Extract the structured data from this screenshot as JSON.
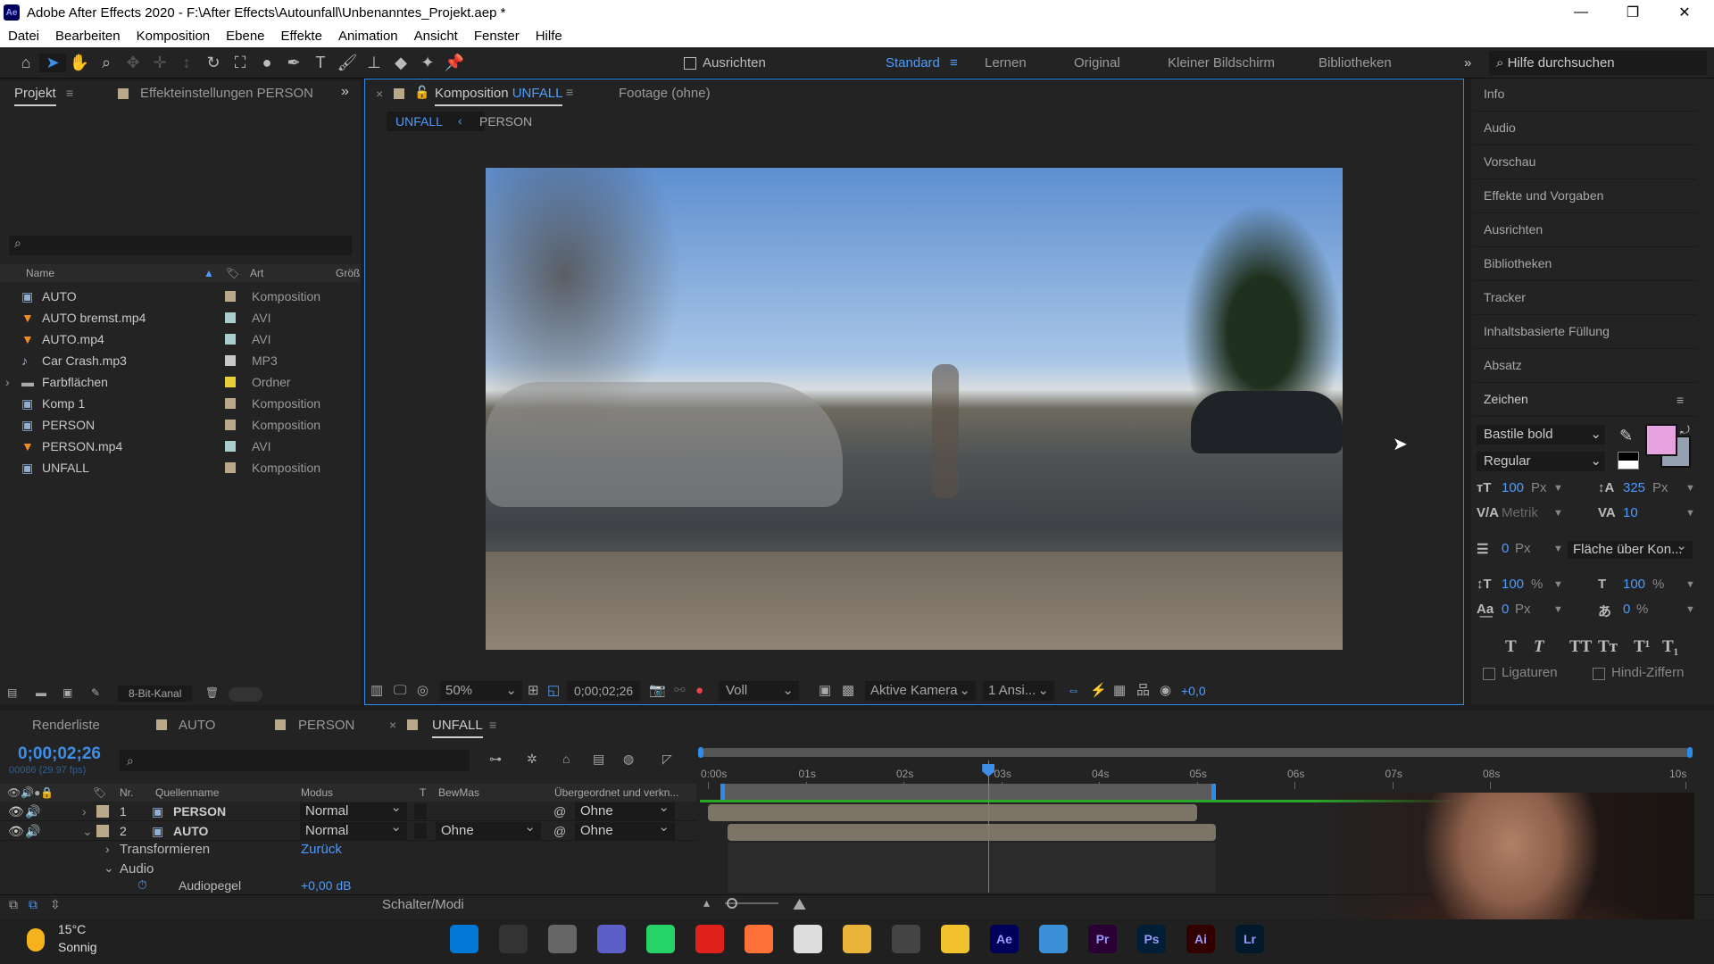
{
  "window": {
    "title": "Adobe After Effects 2020 - F:\\After Effects\\Autounfall\\Unbenanntes_Projekt.aep *",
    "logo": "Ae"
  },
  "menu": [
    "Datei",
    "Bearbeiten",
    "Komposition",
    "Ebene",
    "Effekte",
    "Animation",
    "Ansicht",
    "Fenster",
    "Hilfe"
  ],
  "toolbar": {
    "align_label": "Ausrichten",
    "workspaces": [
      "Standard",
      "Lernen",
      "Original",
      "Kleiner Bildschirm",
      "Bibliotheken"
    ],
    "active_workspace": "Standard",
    "help_placeholder": "Hilfe durchsuchen"
  },
  "project": {
    "tabs": [
      "Projekt",
      "Effekteinstellungen PERSON"
    ],
    "columns": [
      "Name",
      "Art",
      "Größ"
    ],
    "items": [
      {
        "name": "AUTO",
        "type": "Komposition",
        "icon": "composition-icon",
        "color": "#b9a98a"
      },
      {
        "name": "AUTO bremst.mp4",
        "type": "AVI",
        "icon": "video-file-icon",
        "color": "#a9cccc"
      },
      {
        "name": "AUTO.mp4",
        "type": "AVI",
        "icon": "video-file-icon",
        "color": "#a9cccc"
      },
      {
        "name": "Car Crash.mp3",
        "type": "MP3",
        "icon": "audio-file-icon",
        "color": "#c7c7c7"
      },
      {
        "name": "Farbflächen",
        "type": "Ordner",
        "icon": "folder-icon",
        "color": "#e6cf3c"
      },
      {
        "name": "Komp 1",
        "type": "Komposition",
        "icon": "composition-icon",
        "color": "#b9a98a"
      },
      {
        "name": "PERSON",
        "type": "Komposition",
        "icon": "composition-icon",
        "color": "#b9a98a"
      },
      {
        "name": "PERSON.mp4",
        "type": "AVI",
        "icon": "video-file-icon",
        "color": "#a9cccc"
      },
      {
        "name": "UNFALL",
        "type": "Komposition",
        "icon": "composition-icon",
        "color": "#b9a98a"
      }
    ],
    "bit_depth": "8-Bit-Kanal"
  },
  "composition": {
    "tab_prefix": "Komposition",
    "tab_name": "UNFALL",
    "footage_tab": "Footage (ohne)",
    "breadcrumbs": [
      "UNFALL",
      "PERSON"
    ],
    "zoom": "50%",
    "timecode": "0;00;02;26",
    "resolution": "Voll",
    "camera": "Aktive Kamera",
    "views": "1 Ansi...",
    "exposure": "+0,0"
  },
  "right_panel": {
    "sections": [
      "Info",
      "Audio",
      "Vorschau",
      "Effekte und Vorgaben",
      "Ausrichten",
      "Bibliotheken",
      "Tracker",
      "Inhaltsbasierte Füllung",
      "Absatz",
      "Zeichen"
    ],
    "character": {
      "font": "Bastile bold",
      "style": "Regular",
      "fill_color": "#e6a3e0",
      "size": "100",
      "size_unit": "Px",
      "leading": "325",
      "leading_unit": "Px",
      "kerning": "Metrik",
      "tracking": "10",
      "stroke": "0",
      "stroke_unit": "Px",
      "stroke_mode": "Fläche über Kon...",
      "vscale": "100",
      "vscale_unit": "%",
      "hscale": "100",
      "hscale_unit": "%",
      "baseline": "0",
      "baseline_unit": "Px",
      "tsume": "0",
      "tsume_unit": "%",
      "styles": [
        "T",
        "T",
        "TT",
        "Tт",
        "T¹",
        "T₁"
      ],
      "ligatures": "Ligaturen",
      "hindi": "Hindi-Ziffern"
    }
  },
  "timeline": {
    "tabs": [
      "Renderliste",
      "AUTO",
      "PERSON",
      "UNFALL"
    ],
    "active_tab": "UNFALL",
    "timecode": "0;00;02;26",
    "frames": "00086 (29.97 fps)",
    "columns": [
      "Nr.",
      "Quellenname",
      "Modus",
      "T",
      "BewMas",
      "Übergeordnet und verkn..."
    ],
    "layers": [
      {
        "nr": "1",
        "name": "PERSON",
        "mode": "Normal",
        "trkmat": "",
        "parent": "Ohne",
        "start": 0,
        "end": 5.0
      },
      {
        "nr": "2",
        "name": "AUTO",
        "mode": "Normal",
        "trkmat": "Ohne",
        "parent": "Ohne",
        "start": 0.2,
        "end": 5.2
      }
    ],
    "properties": [
      {
        "name": "Transformieren",
        "value": "Zurück"
      },
      {
        "name": "Audio",
        "value": ""
      },
      {
        "name": "Audiopegel",
        "value": "+0,00 dB"
      }
    ],
    "ruler": [
      "0:00s",
      "01s",
      "02s",
      "03s",
      "04s",
      "05s",
      "06s",
      "07s",
      "08s",
      "10s"
    ],
    "playhead_seconds": 2.87,
    "work_area": [
      0.13,
      5.2
    ],
    "footer": "Schalter/Modi"
  },
  "taskbar": {
    "temperature": "15°C",
    "weather": "Sonnig",
    "apps": [
      {
        "label": "",
        "color": "#0078d4"
      },
      {
        "label": "",
        "color": "#333"
      },
      {
        "label": "",
        "color": "#666"
      },
      {
        "label": "",
        "color": "#5b5fc7"
      },
      {
        "label": "",
        "color": "#25d366"
      },
      {
        "label": "",
        "color": "#e0201b"
      },
      {
        "label": "",
        "color": "#ff7139"
      },
      {
        "label": "",
        "color": "#ddd"
      },
      {
        "label": "",
        "color": "#e8b43a"
      },
      {
        "label": "",
        "color": "#444"
      },
      {
        "label": "",
        "color": "#f2c12e"
      },
      {
        "label": "Ae",
        "color": "#00005b"
      },
      {
        "label": "",
        "color": "#3a8fd6"
      },
      {
        "label": "Pr",
        "color": "#2a0034"
      },
      {
        "label": "Ps",
        "color": "#001e36"
      },
      {
        "label": "Ai",
        "color": "#330000"
      },
      {
        "label": "Lr",
        "color": "#001a2b"
      }
    ]
  }
}
